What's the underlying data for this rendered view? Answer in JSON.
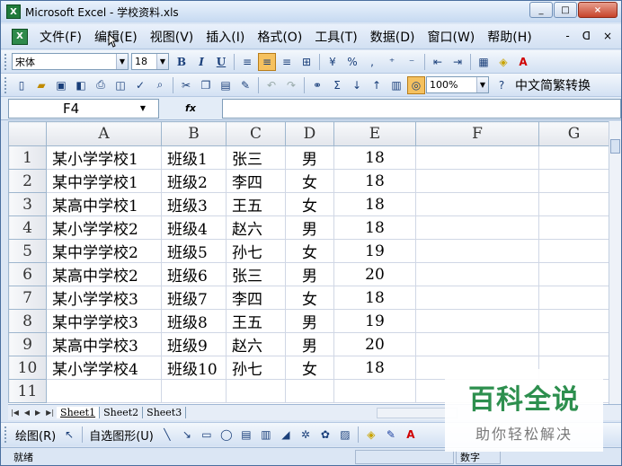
{
  "window": {
    "title": "Microsoft Excel - 学校资料.xls",
    "controls": [
      "_",
      "□",
      "×"
    ]
  },
  "menubar": {
    "items": [
      "文件(F)",
      "编辑(E)",
      "视图(V)",
      "插入(I)",
      "格式(O)",
      "工具(T)",
      "数据(D)",
      "窗口(W)",
      "帮助(H)"
    ],
    "right": [
      "-",
      "ᗡ",
      "×"
    ]
  },
  "format_toolbar": {
    "font": "宋体",
    "size": "18",
    "buttons": [
      "B",
      "I",
      "U"
    ]
  },
  "standard_toolbar": {
    "zoom": "100%",
    "convert_label": "中文简繁转换"
  },
  "formula_bar": {
    "name_box": "F4",
    "fx": "fx",
    "value": ""
  },
  "columns": [
    "A",
    "B",
    "C",
    "D",
    "E",
    "F",
    "G"
  ],
  "rows": [
    {
      "num": "1",
      "A": "某小学学校1",
      "B": "班级1",
      "C": "张三",
      "D": "男",
      "E": "18"
    },
    {
      "num": "2",
      "A": "某中学学校1",
      "B": "班级2",
      "C": "李四",
      "D": "女",
      "E": "18"
    },
    {
      "num": "3",
      "A": "某高中学校1",
      "B": "班级3",
      "C": "王五",
      "D": "女",
      "E": "18"
    },
    {
      "num": "4",
      "A": "某小学学校2",
      "B": "班级4",
      "C": "赵六",
      "D": "男",
      "E": "18"
    },
    {
      "num": "5",
      "A": "某中学学校2",
      "B": "班级5",
      "C": "孙七",
      "D": "女",
      "E": "19"
    },
    {
      "num": "6",
      "A": "某高中学校2",
      "B": "班级6",
      "C": "张三",
      "D": "男",
      "E": "20"
    },
    {
      "num": "7",
      "A": "某小学学校3",
      "B": "班级7",
      "C": "李四",
      "D": "女",
      "E": "18"
    },
    {
      "num": "8",
      "A": "某中学学校3",
      "B": "班级8",
      "C": "王五",
      "D": "男",
      "E": "19"
    },
    {
      "num": "9",
      "A": "某高中学校3",
      "B": "班级9",
      "C": "赵六",
      "D": "男",
      "E": "20"
    },
    {
      "num": "10",
      "A": "某小学学校4",
      "B": "班级10",
      "C": "孙七",
      "D": "女",
      "E": "18"
    },
    {
      "num": "11",
      "A": "",
      "B": "",
      "C": "",
      "D": "",
      "E": ""
    }
  ],
  "sheet_tabs": [
    "Sheet1",
    "Sheet2",
    "Sheet3"
  ],
  "draw_toolbar": {
    "draw_label": "绘图(R)",
    "autoshape_label": "自选图形(U)"
  },
  "statusbar": {
    "ready": "就绪",
    "mode": "数字"
  },
  "watermark": {
    "title": "百科全说",
    "subtitle": "助你轻松解决"
  },
  "colors": {
    "accent": "#2d8f4e",
    "chrome": "#dbe6f4"
  }
}
